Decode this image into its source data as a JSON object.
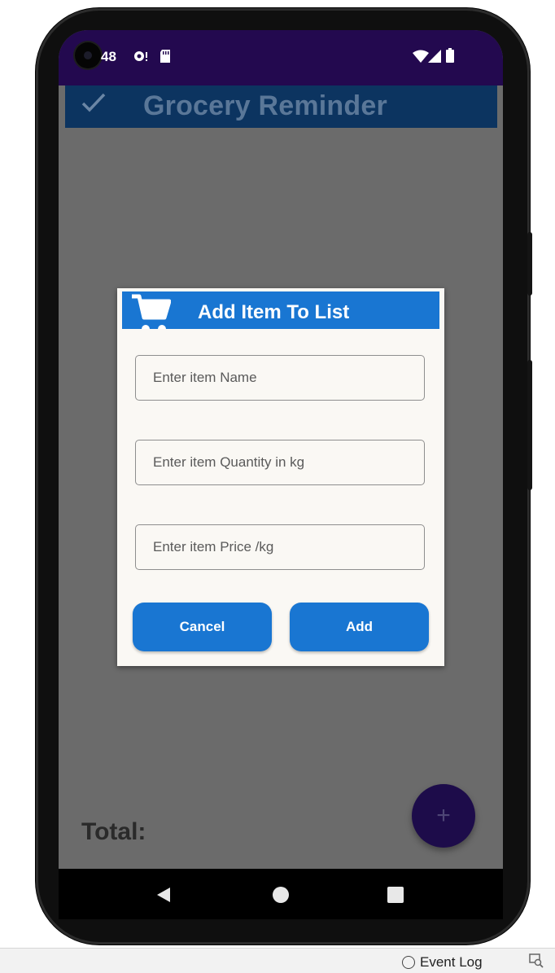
{
  "status_bar": {
    "time": "48",
    "icons": [
      "camera-icon",
      "notification-icon",
      "sd-card-icon",
      "wifi-icon",
      "signal-icon",
      "battery-icon"
    ]
  },
  "app_bar": {
    "check_icon": "check-icon",
    "title": "Grocery Reminder"
  },
  "dialog": {
    "icon": "shopping-cart-icon",
    "title": "Add Item To List",
    "fields": {
      "name_placeholder": "Enter item Name",
      "quantity_placeholder": "Enter item Quantity in kg",
      "price_placeholder": "Enter item Price /kg"
    },
    "cancel_label": "Cancel",
    "add_label": "Add"
  },
  "main": {
    "total_label": "Total:",
    "fab_label": "+"
  },
  "nav_bar": {
    "icons": [
      "back-icon",
      "home-icon",
      "recents-icon"
    ]
  },
  "ide": {
    "event_log_label": "Event Log"
  },
  "colors": {
    "status_bar": "#23094f",
    "app_bar": "#0c3460",
    "accent": "#1976d2",
    "scrim": "#6b6b6b",
    "dialog_bg": "#faf8f4",
    "fab": "#1d0c4a"
  }
}
